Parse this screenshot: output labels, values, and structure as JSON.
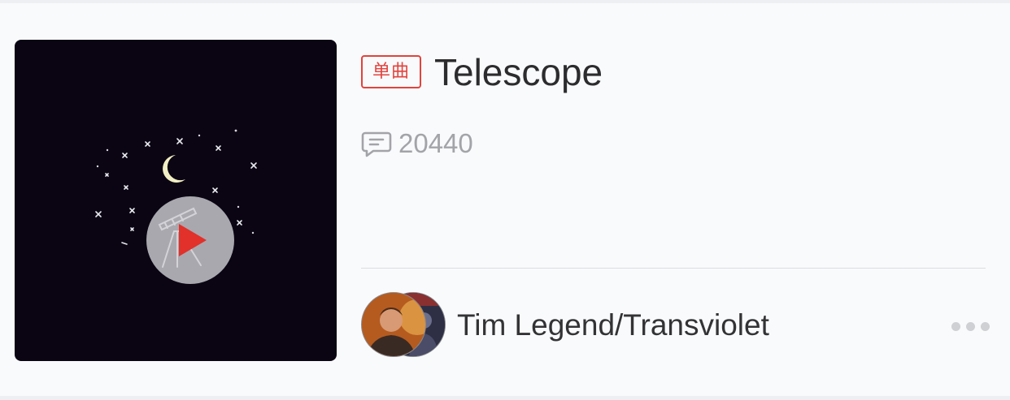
{
  "song": {
    "tag": "单曲",
    "title": "Telescope",
    "comment_count": "20440",
    "artist": "Tim Legend/Transviolet"
  },
  "icons": {
    "play": "play-icon",
    "comment": "comment-icon",
    "more": "more-dots-icon"
  },
  "colors": {
    "accent_red": "#e3423d",
    "cover_background": "#0b0513",
    "page_background": "#f9fafc",
    "muted_text": "#a3a4a8"
  }
}
